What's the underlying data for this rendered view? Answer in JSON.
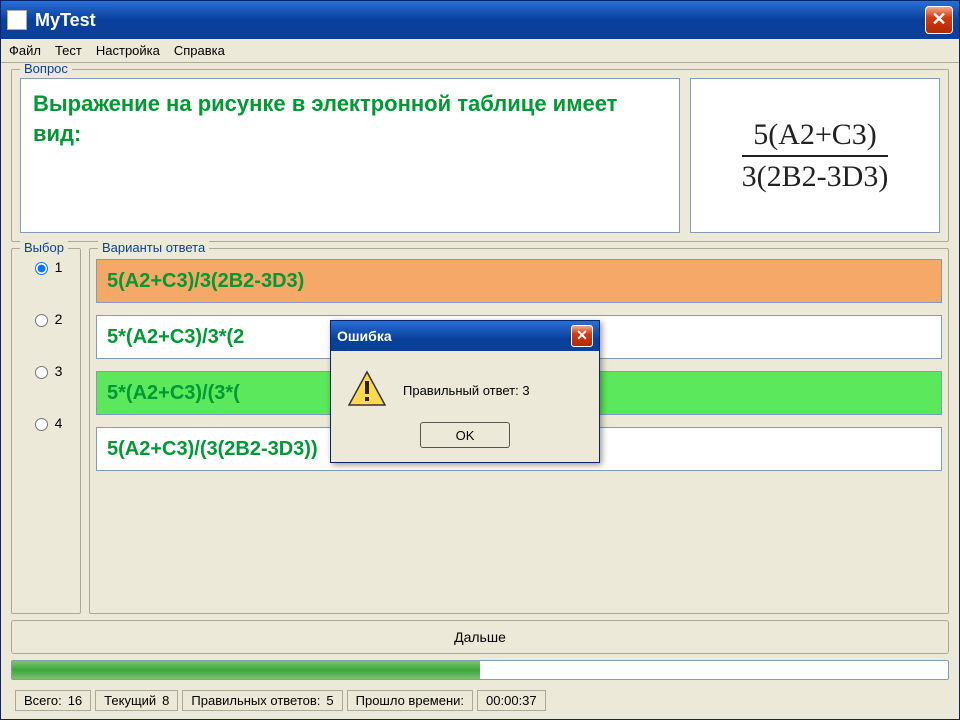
{
  "window": {
    "title": "MyTest"
  },
  "menu": {
    "file": "Файл",
    "test": "Тест",
    "settings": "Настройка",
    "help": "Справка"
  },
  "question": {
    "label": "Вопрос",
    "text": "Выражение на рисунке в электронной таблице имеет вид:",
    "formula_num": "5(A2+C3)",
    "formula_den": "3(2B2-3D3)"
  },
  "choice_label": "Выбор",
  "answers_label": "Варианты ответа",
  "answers": [
    {
      "n": "1",
      "text": "5(A2+C3)/3(2B2-3D3)",
      "state": "sel-wrong",
      "selected": true
    },
    {
      "n": "2",
      "text": "5*(A2+C3)/3*(2",
      "state": "",
      "selected": false
    },
    {
      "n": "3",
      "text": "5*(A2+C3)/(3*(",
      "state": "correct",
      "selected": false
    },
    {
      "n": "4",
      "text": "5(A2+C3)/(3(2B2-3D3))",
      "state": "",
      "selected": false
    }
  ],
  "next_button": "Дальше",
  "progress_percent": 50,
  "status": {
    "total_label": "Всего:",
    "total_val": "16",
    "current_label": "Текущий",
    "current_val": "8",
    "correct_label": "Правильных ответов:",
    "correct_val": "5",
    "elapsed_label": "Прошло времени:",
    "elapsed_val": "00:00:37"
  },
  "dialog": {
    "title": "Ошибка",
    "message": "Правильный ответ: 3",
    "ok": "OK"
  }
}
